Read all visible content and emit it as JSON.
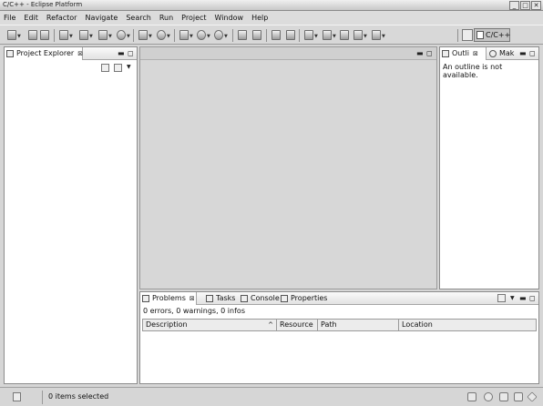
{
  "window": {
    "title": "C/C++ - Eclipse Platform"
  },
  "menu": [
    "File",
    "Edit",
    "Refactor",
    "Navigate",
    "Search",
    "Run",
    "Project",
    "Window",
    "Help"
  ],
  "perspective": {
    "label": "C/C++"
  },
  "project_explorer": {
    "title": "Project Explorer"
  },
  "outline": {
    "tab_outline": "Outli",
    "tab_make": "Mak",
    "message": "An outline is not available."
  },
  "bottom": {
    "tabs": [
      "Problems",
      "Tasks",
      "Console",
      "Properties"
    ],
    "summary": "0 errors, 0 warnings, 0 infos",
    "columns": [
      "Description",
      "Resource",
      "Path",
      "Location"
    ],
    "sort_indicator": "^"
  },
  "status": {
    "text": "0 items selected"
  },
  "glyphs": {
    "close": "⊠",
    "minimize": "▬",
    "maximize": "◻",
    "dropdown": "▼",
    "win_close": "✕",
    "win_max": "□",
    "win_min": "_"
  }
}
